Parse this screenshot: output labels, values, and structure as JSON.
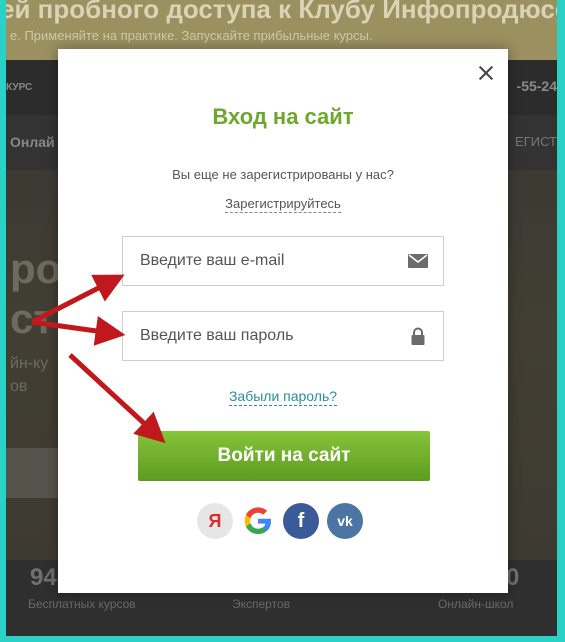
{
  "background": {
    "headline": "ей пробного доступа к Клубу Инфопродюсеров",
    "subtitle": "е. Применяйте на практике. Запускайте прибыльные курсы.",
    "kurs": "КУРС",
    "phone": "-55-24",
    "online": "Онлай",
    "register": "ЕГИСТ",
    "big_line1": "ро",
    "big_line2": "ст",
    "line3": "йн-ку",
    "line4": "ов",
    "stats": [
      {
        "num": "94",
        "label": "Бесплатных курсов"
      },
      {
        "num": "",
        "label": "Экспертов"
      },
      {
        "num": "0",
        "label": "Онлайн-школ"
      }
    ]
  },
  "modal": {
    "title": "Вход на сайт",
    "subtitle": "Вы еще не зарегистрированы у нас?",
    "register_link": "Зарегистрируйтесь",
    "email_placeholder": "Введите ваш e-mail",
    "password_placeholder": "Введите ваш пароль",
    "forgot_link": "Забыли пароль?",
    "login_button": "Войти на сайт",
    "socials": {
      "yandex": "Я",
      "facebook": "f",
      "vk": "vk"
    }
  },
  "colors": {
    "frame": "#2ad1c6",
    "title_green": "#6fa72e",
    "button_green": "#6fae2c",
    "link_teal": "#2a8ea0",
    "arrow_red": "#c0181c"
  },
  "icons": {
    "close": "close-icon",
    "email": "envelope-icon",
    "password": "lock-icon",
    "yandex": "yandex-icon",
    "google": "google-icon",
    "facebook": "facebook-icon",
    "vk": "vk-icon"
  }
}
